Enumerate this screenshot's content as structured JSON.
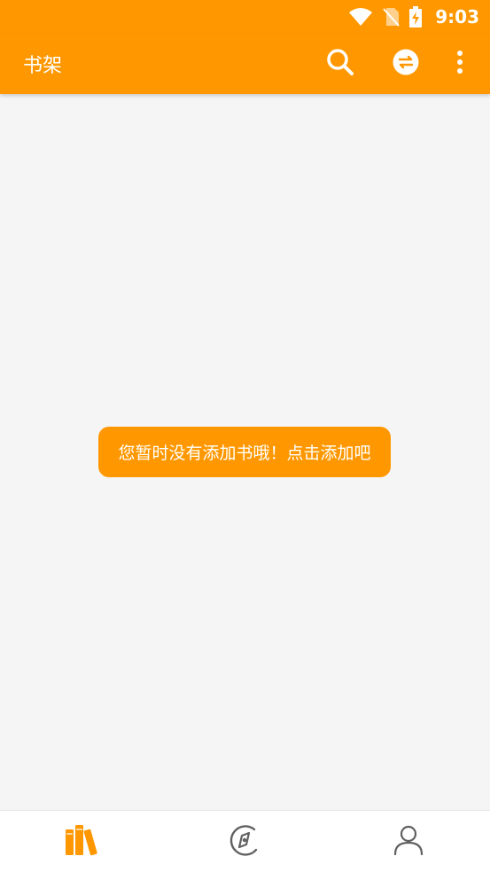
{
  "status_bar": {
    "time": "9:03"
  },
  "app_bar": {
    "title": "书架",
    "actions": [
      {
        "icon": "search-icon"
      },
      {
        "icon": "swap-icon"
      },
      {
        "icon": "more-vert-icon"
      }
    ]
  },
  "main": {
    "empty_message": "您暂时没有添加书哦！点击添加吧"
  },
  "bottom_nav": {
    "items": [
      {
        "icon": "bookshelf-icon",
        "active": true
      },
      {
        "icon": "compass-icon",
        "active": false
      },
      {
        "icon": "person-icon",
        "active": false
      }
    ]
  },
  "colors": {
    "accent": "#ff9800",
    "background": "#f5f5f5",
    "nav_inactive": "#616161"
  }
}
